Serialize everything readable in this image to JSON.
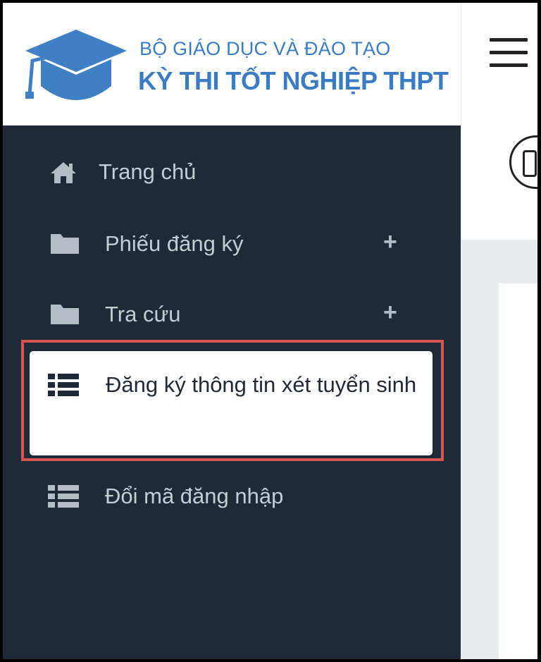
{
  "header": {
    "org_name": "BỘ GIÁO DỤC VÀ ĐÀO TẠO",
    "exam_title": "KỲ THI TỐT NGHIỆP THPT",
    "logo_icon": "graduation-cap-icon",
    "brand_color": "#3a7cc3"
  },
  "topbar": {
    "menu_icon": "hamburger-menu-icon"
  },
  "sidebar": {
    "background": "#1f2937",
    "items": [
      {
        "label": "Trang chủ",
        "icon": "home-icon"
      },
      {
        "label": "Phiếu đăng ký",
        "icon": "folder-icon",
        "expand": "+"
      },
      {
        "label": "Tra cứu",
        "icon": "folder-icon",
        "expand": "+"
      },
      {
        "label": "Đăng ký thông tin xét tuyển sinh",
        "icon": "list-icon",
        "active": true
      },
      {
        "label": "Đổi mã đăng nhập",
        "icon": "list-icon"
      }
    ],
    "highlight_color": "#d9534f"
  }
}
